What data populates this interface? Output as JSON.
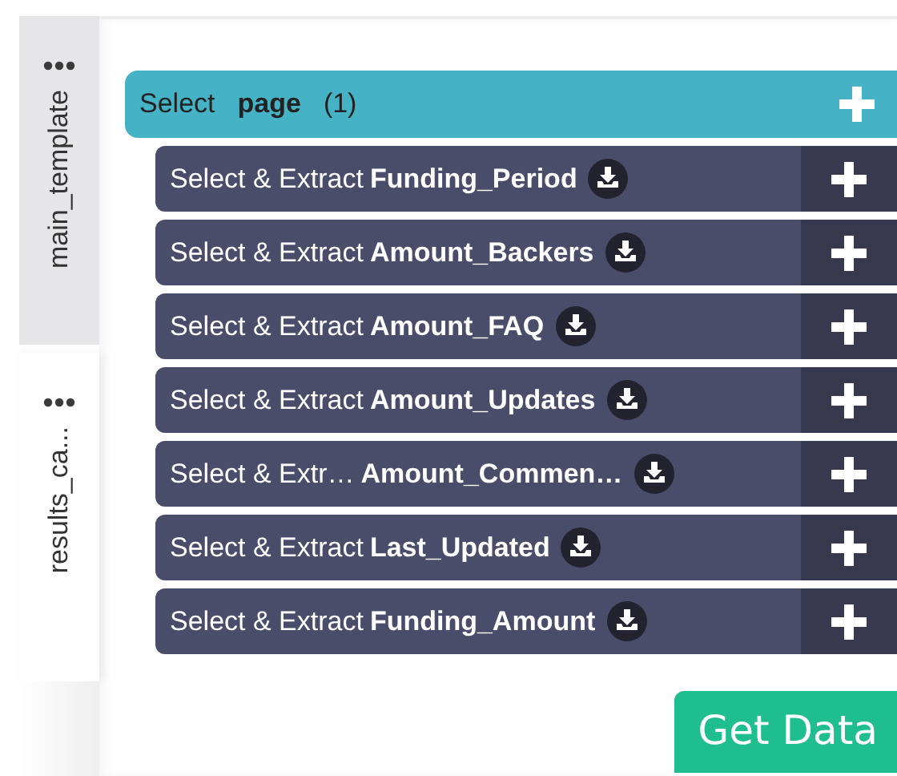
{
  "side_tabs": [
    {
      "label": "main_template",
      "selected": false
    },
    {
      "label": "results_ca...",
      "selected": true
    }
  ],
  "root": {
    "prefix": "Select",
    "name": "page",
    "count": "(1)"
  },
  "rows": [
    {
      "prefix": "Select & Extract",
      "name": "Funding_Period"
    },
    {
      "prefix": "Select & Extract",
      "name": "Amount_Backers"
    },
    {
      "prefix": "Select & Extract",
      "name": "Amount_FAQ"
    },
    {
      "prefix": "Select & Extract",
      "name": "Amount_Updates"
    },
    {
      "prefix": "Select & Extr…",
      "name": "Amount_Commen…"
    },
    {
      "prefix": "Select & Extract",
      "name": "Last_Updated"
    },
    {
      "prefix": "Select & Extract",
      "name": "Funding_Amount"
    }
  ],
  "button": "Get Data"
}
